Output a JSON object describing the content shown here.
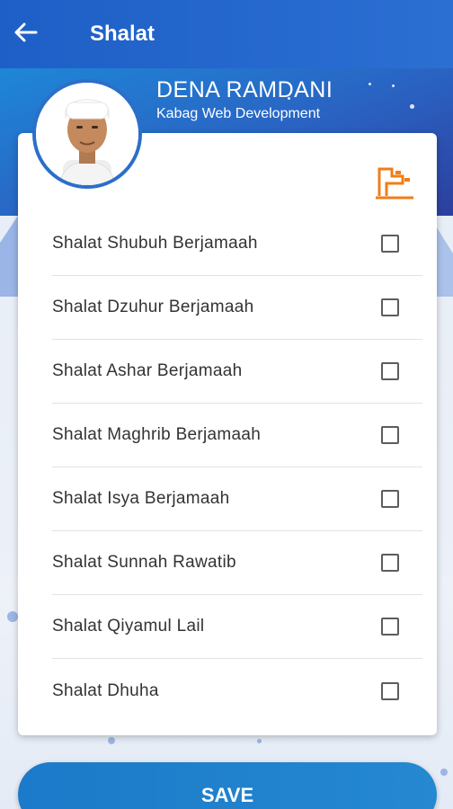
{
  "appbar": {
    "title": "Shalat",
    "back_icon": "arrow-left-icon"
  },
  "profile": {
    "name": "DENA RAMDANI",
    "role": "Kabag Web Development",
    "avatar_icon": "user-photo"
  },
  "card": {
    "logo_icon": "brand-logo-icon",
    "items": [
      {
        "label": "Shalat Shubuh Berjamaah",
        "checked": false
      },
      {
        "label": "Shalat Dzuhur Berjamaah",
        "checked": false
      },
      {
        "label": "Shalat Ashar Berjamaah",
        "checked": false
      },
      {
        "label": "Shalat Maghrib Berjamaah",
        "checked": false
      },
      {
        "label": "Shalat Isya Berjamaah",
        "checked": false
      },
      {
        "label": "Shalat Sunnah Rawatib",
        "checked": false
      },
      {
        "label": "Shalat Qiyamul Lail",
        "checked": false
      },
      {
        "label": "Shalat Dhuha",
        "checked": false
      }
    ]
  },
  "footer": {
    "save_label": "SAVE"
  },
  "colors": {
    "primary": "#2c6fd3",
    "accent": "#f07d1a",
    "button": "#1f80cc"
  }
}
